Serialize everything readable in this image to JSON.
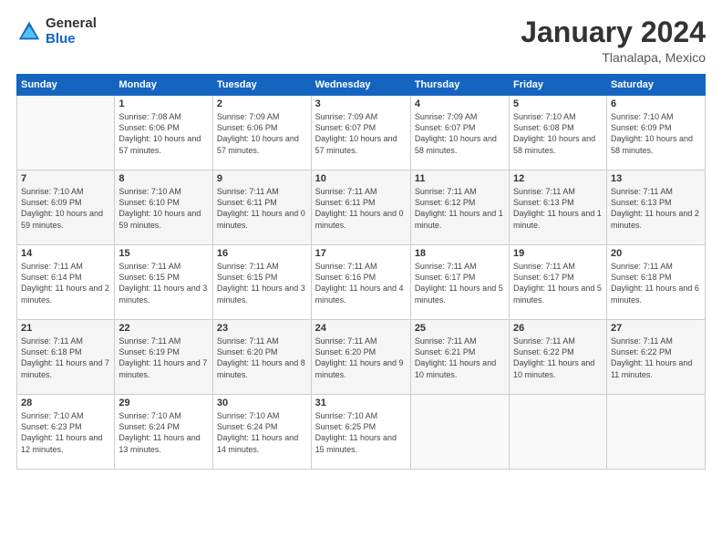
{
  "logo": {
    "general": "General",
    "blue": "Blue"
  },
  "calendar": {
    "title": "January 2024",
    "subtitle": "Tlanalapa, Mexico"
  },
  "days_of_week": [
    "Sunday",
    "Monday",
    "Tuesday",
    "Wednesday",
    "Thursday",
    "Friday",
    "Saturday"
  ],
  "weeks": [
    [
      {
        "day": "",
        "sunrise": "",
        "sunset": "",
        "daylight": "",
        "empty": true
      },
      {
        "day": "1",
        "sunrise": "Sunrise: 7:08 AM",
        "sunset": "Sunset: 6:06 PM",
        "daylight": "Daylight: 10 hours and 57 minutes."
      },
      {
        "day": "2",
        "sunrise": "Sunrise: 7:09 AM",
        "sunset": "Sunset: 6:06 PM",
        "daylight": "Daylight: 10 hours and 57 minutes."
      },
      {
        "day": "3",
        "sunrise": "Sunrise: 7:09 AM",
        "sunset": "Sunset: 6:07 PM",
        "daylight": "Daylight: 10 hours and 57 minutes."
      },
      {
        "day": "4",
        "sunrise": "Sunrise: 7:09 AM",
        "sunset": "Sunset: 6:07 PM",
        "daylight": "Daylight: 10 hours and 58 minutes."
      },
      {
        "day": "5",
        "sunrise": "Sunrise: 7:10 AM",
        "sunset": "Sunset: 6:08 PM",
        "daylight": "Daylight: 10 hours and 58 minutes."
      },
      {
        "day": "6",
        "sunrise": "Sunrise: 7:10 AM",
        "sunset": "Sunset: 6:09 PM",
        "daylight": "Daylight: 10 hours and 58 minutes."
      }
    ],
    [
      {
        "day": "7",
        "sunrise": "Sunrise: 7:10 AM",
        "sunset": "Sunset: 6:09 PM",
        "daylight": "Daylight: 10 hours and 59 minutes."
      },
      {
        "day": "8",
        "sunrise": "Sunrise: 7:10 AM",
        "sunset": "Sunset: 6:10 PM",
        "daylight": "Daylight: 10 hours and 59 minutes."
      },
      {
        "day": "9",
        "sunrise": "Sunrise: 7:11 AM",
        "sunset": "Sunset: 6:11 PM",
        "daylight": "Daylight: 11 hours and 0 minutes."
      },
      {
        "day": "10",
        "sunrise": "Sunrise: 7:11 AM",
        "sunset": "Sunset: 6:11 PM",
        "daylight": "Daylight: 11 hours and 0 minutes."
      },
      {
        "day": "11",
        "sunrise": "Sunrise: 7:11 AM",
        "sunset": "Sunset: 6:12 PM",
        "daylight": "Daylight: 11 hours and 1 minute."
      },
      {
        "day": "12",
        "sunrise": "Sunrise: 7:11 AM",
        "sunset": "Sunset: 6:13 PM",
        "daylight": "Daylight: 11 hours and 1 minute."
      },
      {
        "day": "13",
        "sunrise": "Sunrise: 7:11 AM",
        "sunset": "Sunset: 6:13 PM",
        "daylight": "Daylight: 11 hours and 2 minutes."
      }
    ],
    [
      {
        "day": "14",
        "sunrise": "Sunrise: 7:11 AM",
        "sunset": "Sunset: 6:14 PM",
        "daylight": "Daylight: 11 hours and 2 minutes."
      },
      {
        "day": "15",
        "sunrise": "Sunrise: 7:11 AM",
        "sunset": "Sunset: 6:15 PM",
        "daylight": "Daylight: 11 hours and 3 minutes."
      },
      {
        "day": "16",
        "sunrise": "Sunrise: 7:11 AM",
        "sunset": "Sunset: 6:15 PM",
        "daylight": "Daylight: 11 hours and 3 minutes."
      },
      {
        "day": "17",
        "sunrise": "Sunrise: 7:11 AM",
        "sunset": "Sunset: 6:16 PM",
        "daylight": "Daylight: 11 hours and 4 minutes."
      },
      {
        "day": "18",
        "sunrise": "Sunrise: 7:11 AM",
        "sunset": "Sunset: 6:17 PM",
        "daylight": "Daylight: 11 hours and 5 minutes."
      },
      {
        "day": "19",
        "sunrise": "Sunrise: 7:11 AM",
        "sunset": "Sunset: 6:17 PM",
        "daylight": "Daylight: 11 hours and 5 minutes."
      },
      {
        "day": "20",
        "sunrise": "Sunrise: 7:11 AM",
        "sunset": "Sunset: 6:18 PM",
        "daylight": "Daylight: 11 hours and 6 minutes."
      }
    ],
    [
      {
        "day": "21",
        "sunrise": "Sunrise: 7:11 AM",
        "sunset": "Sunset: 6:18 PM",
        "daylight": "Daylight: 11 hours and 7 minutes."
      },
      {
        "day": "22",
        "sunrise": "Sunrise: 7:11 AM",
        "sunset": "Sunset: 6:19 PM",
        "daylight": "Daylight: 11 hours and 7 minutes."
      },
      {
        "day": "23",
        "sunrise": "Sunrise: 7:11 AM",
        "sunset": "Sunset: 6:20 PM",
        "daylight": "Daylight: 11 hours and 8 minutes."
      },
      {
        "day": "24",
        "sunrise": "Sunrise: 7:11 AM",
        "sunset": "Sunset: 6:20 PM",
        "daylight": "Daylight: 11 hours and 9 minutes."
      },
      {
        "day": "25",
        "sunrise": "Sunrise: 7:11 AM",
        "sunset": "Sunset: 6:21 PM",
        "daylight": "Daylight: 11 hours and 10 minutes."
      },
      {
        "day": "26",
        "sunrise": "Sunrise: 7:11 AM",
        "sunset": "Sunset: 6:22 PM",
        "daylight": "Daylight: 11 hours and 10 minutes."
      },
      {
        "day": "27",
        "sunrise": "Sunrise: 7:11 AM",
        "sunset": "Sunset: 6:22 PM",
        "daylight": "Daylight: 11 hours and 11 minutes."
      }
    ],
    [
      {
        "day": "28",
        "sunrise": "Sunrise: 7:10 AM",
        "sunset": "Sunset: 6:23 PM",
        "daylight": "Daylight: 11 hours and 12 minutes."
      },
      {
        "day": "29",
        "sunrise": "Sunrise: 7:10 AM",
        "sunset": "Sunset: 6:24 PM",
        "daylight": "Daylight: 11 hours and 13 minutes."
      },
      {
        "day": "30",
        "sunrise": "Sunrise: 7:10 AM",
        "sunset": "Sunset: 6:24 PM",
        "daylight": "Daylight: 11 hours and 14 minutes."
      },
      {
        "day": "31",
        "sunrise": "Sunrise: 7:10 AM",
        "sunset": "Sunset: 6:25 PM",
        "daylight": "Daylight: 11 hours and 15 minutes."
      },
      {
        "day": "",
        "sunrise": "",
        "sunset": "",
        "daylight": "",
        "empty": true
      },
      {
        "day": "",
        "sunrise": "",
        "sunset": "",
        "daylight": "",
        "empty": true
      },
      {
        "day": "",
        "sunrise": "",
        "sunset": "",
        "daylight": "",
        "empty": true
      }
    ]
  ]
}
